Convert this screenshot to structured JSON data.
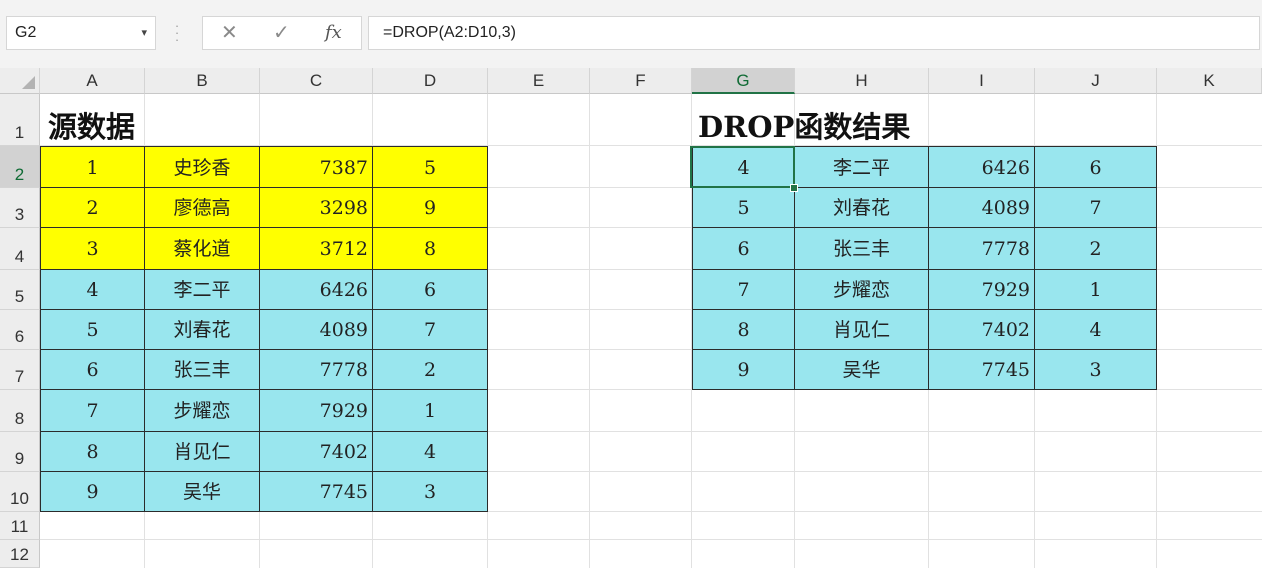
{
  "name_box": {
    "value": "G2"
  },
  "formula_bar": {
    "cancel_icon": "✕",
    "enter_icon": "✓",
    "fx_label": "fx",
    "formula": "=DROP(A2:D10,3)"
  },
  "columns": [
    "A",
    "B",
    "C",
    "D",
    "E",
    "F",
    "G",
    "H",
    "I",
    "J",
    "K"
  ],
  "rows": [
    "1",
    "2",
    "3",
    "4",
    "5",
    "6",
    "7",
    "8",
    "9",
    "10",
    "11",
    "12"
  ],
  "selected_column": "G",
  "selected_row": "2",
  "source_title": "源数据",
  "result_title": "DROP函数结果",
  "colors": {
    "dropped_rows": "#ffff00",
    "kept_rows": "#99e6ee",
    "selection": "#217346"
  },
  "source_table": [
    [
      "1",
      "史珍香",
      "7387",
      "5"
    ],
    [
      "2",
      "廖德高",
      "3298",
      "9"
    ],
    [
      "3",
      "蔡化道",
      "3712",
      "8"
    ],
    [
      "4",
      "李二平",
      "6426",
      "6"
    ],
    [
      "5",
      "刘春花",
      "4089",
      "7"
    ],
    [
      "6",
      "张三丰",
      "7778",
      "2"
    ],
    [
      "7",
      "步耀恋",
      "7929",
      "1"
    ],
    [
      "8",
      "肖见仁",
      "7402",
      "4"
    ],
    [
      "9",
      "吴华",
      "7745",
      "3"
    ]
  ],
  "result_table": [
    [
      "4",
      "李二平",
      "6426",
      "6"
    ],
    [
      "5",
      "刘春花",
      "4089",
      "7"
    ],
    [
      "6",
      "张三丰",
      "7778",
      "2"
    ],
    [
      "7",
      "步耀恋",
      "7929",
      "1"
    ],
    [
      "8",
      "肖见仁",
      "7402",
      "4"
    ],
    [
      "9",
      "吴华",
      "7745",
      "3"
    ]
  ]
}
